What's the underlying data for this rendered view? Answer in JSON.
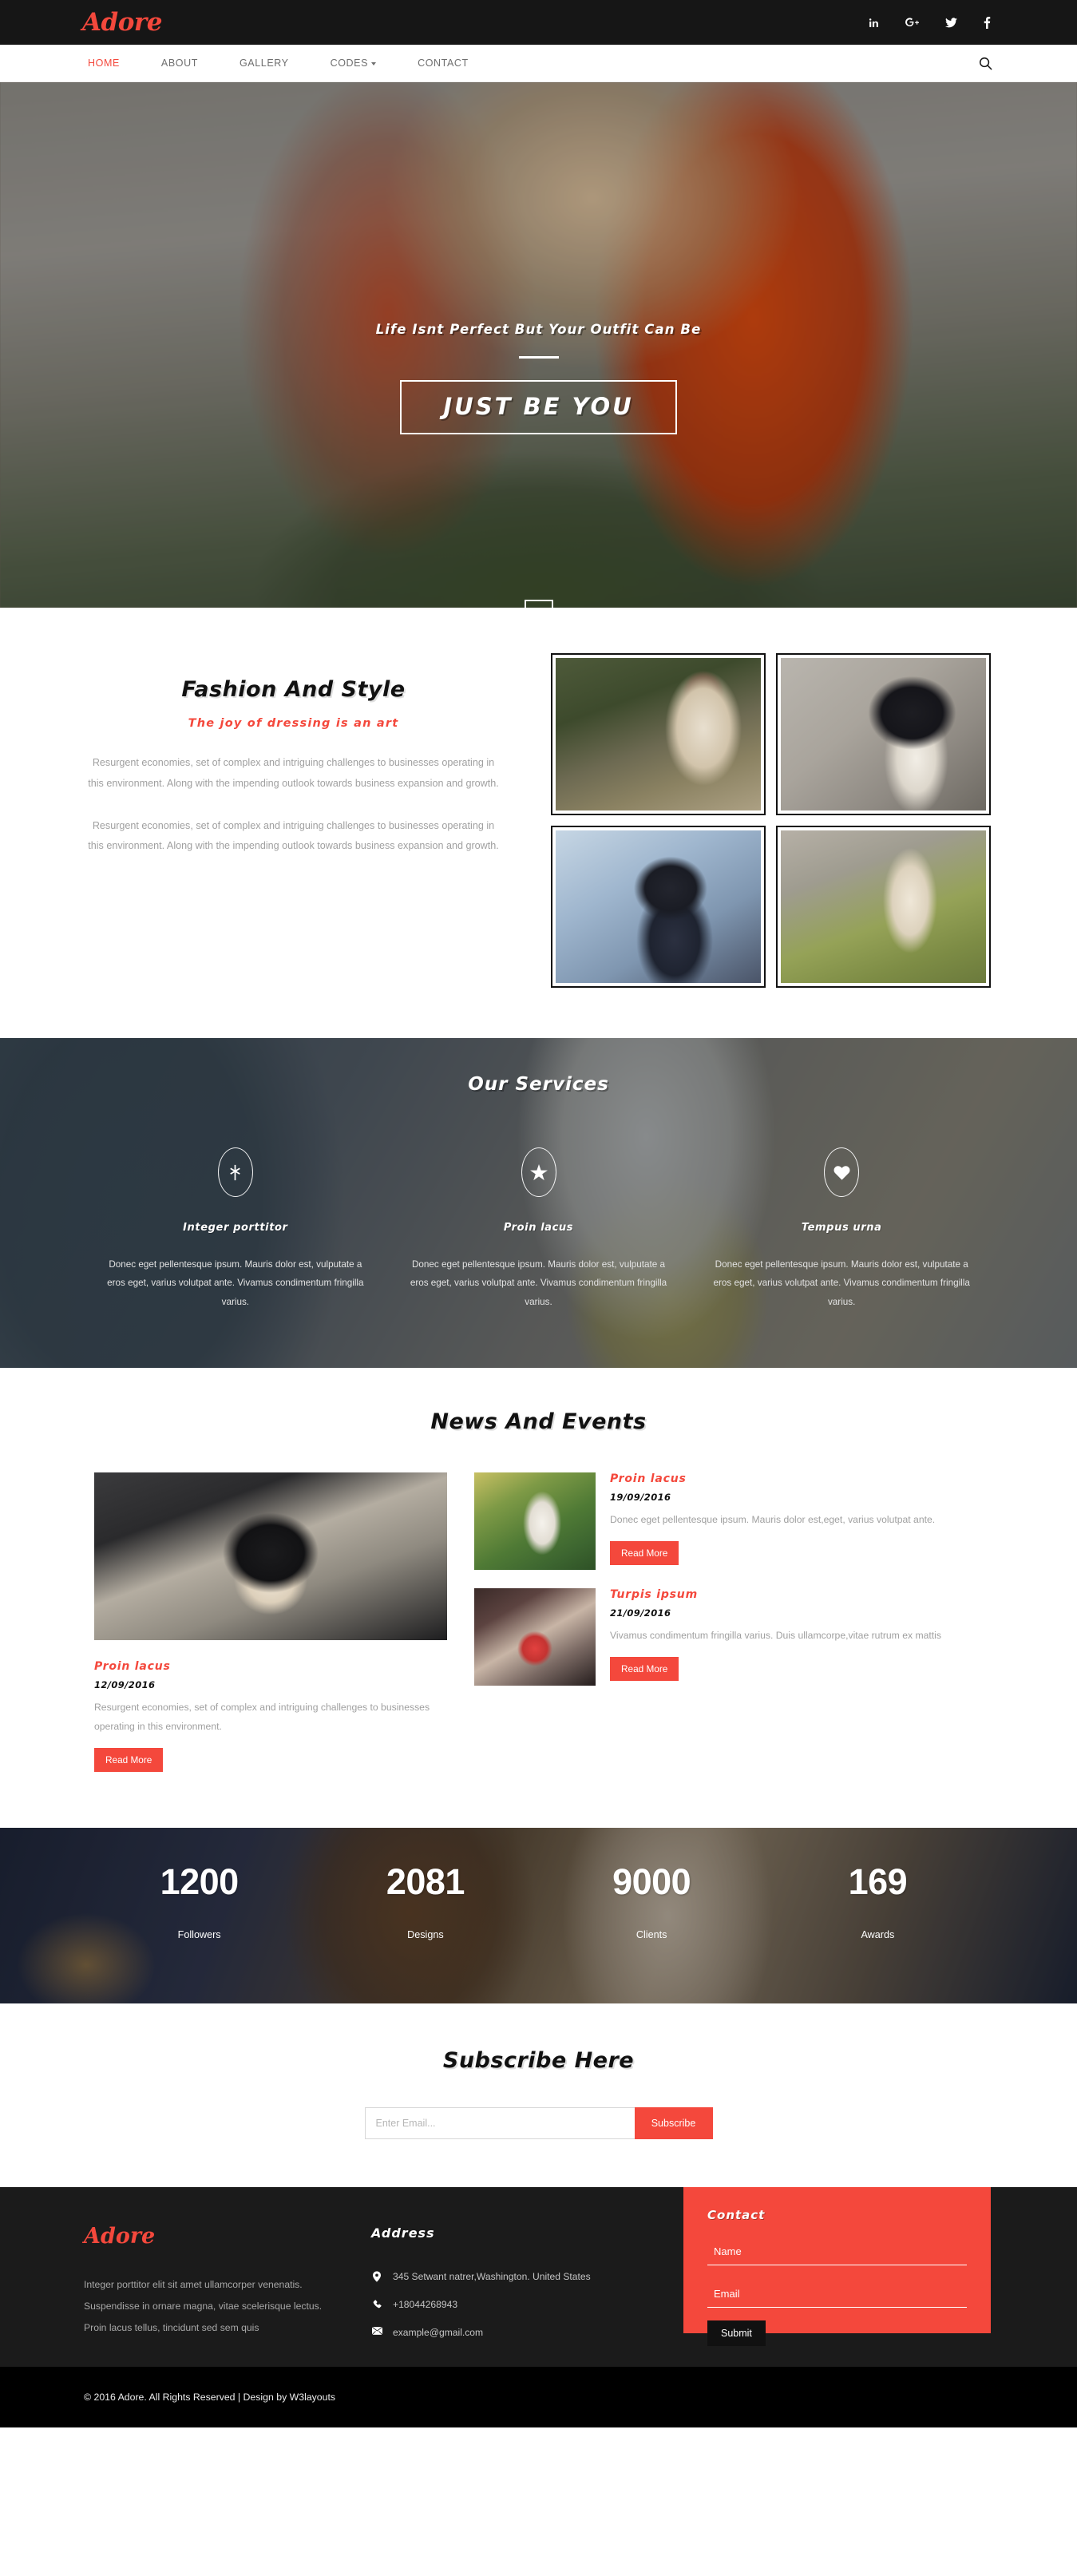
{
  "brand": {
    "name": "Adore"
  },
  "social": [
    {
      "name": "linkedin-icon",
      "label": "in"
    },
    {
      "name": "googleplus-icon",
      "label": "G+"
    },
    {
      "name": "twitter-icon",
      "label": "twitter"
    },
    {
      "name": "facebook-icon",
      "label": "f"
    }
  ],
  "nav": {
    "items": [
      {
        "label": "HOME",
        "active": true,
        "dropdown": false
      },
      {
        "label": "ABOUT",
        "active": false,
        "dropdown": false
      },
      {
        "label": "GALLERY",
        "active": false,
        "dropdown": false
      },
      {
        "label": "CODES",
        "active": false,
        "dropdown": true
      },
      {
        "label": "CONTACT",
        "active": false,
        "dropdown": false
      }
    ],
    "search_icon": "search-icon"
  },
  "hero": {
    "subtitle": "Life Isnt Perfect But Your Outfit Can Be",
    "title": "JUST BE YOU",
    "scroll_icon": "arrow-down-icon"
  },
  "about": {
    "heading": "Fashion And Style",
    "subheading": "The joy of dressing is an art",
    "paragraph1": "Resurgent economies, set of complex and intriguing challenges to businesses operating in this environment. Along with the impending outlook towards business expansion and growth.",
    "paragraph2": "Resurgent economies, set of complex and intriguing challenges to businesses operating in this environment. Along with the impending outlook towards business expansion and growth."
  },
  "services": {
    "title": "Our Services",
    "items": [
      {
        "icon": "asterisk-icon",
        "name": "Integer porttitor",
        "text": "Donec eget pellentesque ipsum. Mauris dolor est, vulputate a eros eget, varius volutpat ante. Vivamus condimentum fringilla varius."
      },
      {
        "icon": "star-icon",
        "name": "Proin lacus",
        "text": "Donec eget pellentesque ipsum. Mauris dolor est, vulputate a eros eget, varius volutpat ante. Vivamus condimentum fringilla varius."
      },
      {
        "icon": "heart-icon",
        "name": "Tempus urna",
        "text": "Donec eget pellentesque ipsum. Mauris dolor est, vulputate a eros eget, varius volutpat ante. Vivamus condimentum fringilla varius."
      }
    ]
  },
  "news": {
    "title": "News And Events",
    "featured": {
      "title": "Proin lacus",
      "date": "12/09/2016",
      "text": "Resurgent economies, set of complex and intriguing challenges to businesses operating in this environment.",
      "button": "Read More"
    },
    "items": [
      {
        "title": "Proin lacus",
        "date": "19/09/2016",
        "text": "Donec eget pellentesque ipsum. Mauris dolor est,eget, varius volutpat ante.",
        "button": "Read More"
      },
      {
        "title": "Turpis ipsum",
        "date": "21/09/2016",
        "text": "Vivamus condimentum fringilla varius. Duis ullamcorpe,vitae rutrum ex mattis",
        "button": "Read More"
      }
    ]
  },
  "stats": [
    {
      "number": "1200",
      "label": "Followers"
    },
    {
      "number": "2081",
      "label": "Designs"
    },
    {
      "number": "9000",
      "label": "Clients"
    },
    {
      "number": "169",
      "label": "Awards"
    }
  ],
  "subscribe": {
    "title": "Subscribe Here",
    "placeholder": "Enter Email...",
    "button": "Subscribe"
  },
  "footer": {
    "logo": "Adore",
    "lines": [
      "Integer porttitor elit sit amet ullamcorper venenatis.",
      "Suspendisse in ornare magna, vitae scelerisque lectus.",
      "Proin lacus tellus, tincidunt sed sem quis"
    ],
    "address_heading": "Address",
    "address": "345 Setwant natrer,Washington. United States",
    "phone": "+18044268943",
    "email": "example@gmail.com",
    "contact_heading": "Contact",
    "name_placeholder": "Name",
    "email_placeholder": "Email",
    "submit": "Submit",
    "copyright": "© 2016 Adore. All Rights Reserved | Design by W3layouts"
  },
  "colors": {
    "accent": "#f4483c",
    "dark": "#161616",
    "black": "#000000"
  }
}
